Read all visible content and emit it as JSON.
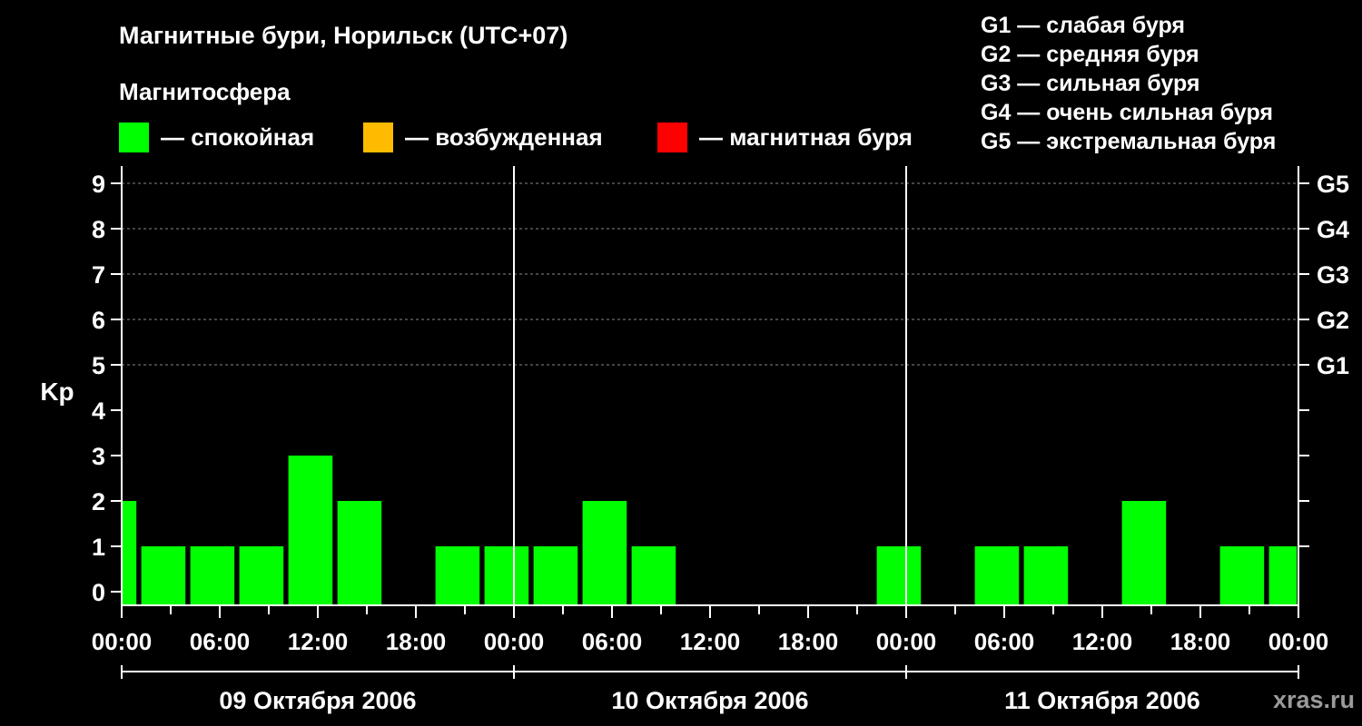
{
  "title": "Магнитные бури, Норильск (UTC+07)",
  "subtitle": "Магнитосфера",
  "legend": [
    {
      "label": "— спокойная",
      "color": "#00ff00"
    },
    {
      "label": "— возбужденная",
      "color": "#ffbb00"
    },
    {
      "label": "— магнитная буря",
      "color": "#ff0000"
    }
  ],
  "g_legend": [
    "G1 — слабая буря",
    "G2 — средняя буря",
    "G3 — сильная буря",
    "G4 — очень сильная буря",
    "G5 — экстремальная буря"
  ],
  "brand": "xras.ru",
  "chart_data": {
    "type": "bar",
    "ylabel": "Kp",
    "ylim": [
      0,
      9
    ],
    "yticks": [
      "0",
      "1",
      "2",
      "3",
      "4",
      "5",
      "6",
      "7",
      "8",
      "9"
    ],
    "right_ticks": [
      {
        "kp": 5,
        "label": "G1"
      },
      {
        "kp": 6,
        "label": "G2"
      },
      {
        "kp": 7,
        "label": "G3"
      },
      {
        "kp": 8,
        "label": "G4"
      },
      {
        "kp": 9,
        "label": "G5"
      }
    ],
    "grid": "dashed horizontal at Kp 5–9",
    "xlim_hours": [
      0,
      72
    ],
    "xtick_labels": [
      "00:00",
      "06:00",
      "12:00",
      "18:00",
      "00:00",
      "06:00",
      "12:00",
      "18:00",
      "00:00",
      "06:00",
      "12:00",
      "18:00",
      "00:00"
    ],
    "day_labels": [
      "09 Октября 2006",
      "10 Октября 2006",
      "11 Октября 2006"
    ],
    "bars": [
      {
        "start": 0,
        "end": 0.9,
        "kp": 2,
        "color": "#00ff00"
      },
      {
        "start": 1.2,
        "end": 3.9,
        "kp": 1,
        "color": "#00ff00"
      },
      {
        "start": 4.2,
        "end": 6.9,
        "kp": 1,
        "color": "#00ff00"
      },
      {
        "start": 7.2,
        "end": 9.9,
        "kp": 1,
        "color": "#00ff00"
      },
      {
        "start": 10.2,
        "end": 12.9,
        "kp": 3,
        "color": "#00ff00"
      },
      {
        "start": 13.2,
        "end": 15.9,
        "kp": 2,
        "color": "#00ff00"
      },
      {
        "start": 19.2,
        "end": 21.9,
        "kp": 1,
        "color": "#00ff00"
      },
      {
        "start": 22.2,
        "end": 24.9,
        "kp": 1,
        "color": "#00ff00"
      },
      {
        "start": 25.2,
        "end": 27.9,
        "kp": 1,
        "color": "#00ff00"
      },
      {
        "start": 28.2,
        "end": 30.9,
        "kp": 2,
        "color": "#00ff00"
      },
      {
        "start": 31.2,
        "end": 33.9,
        "kp": 1,
        "color": "#00ff00"
      },
      {
        "start": 46.2,
        "end": 48.9,
        "kp": 1,
        "color": "#00ff00"
      },
      {
        "start": 52.2,
        "end": 54.9,
        "kp": 1,
        "color": "#00ff00"
      },
      {
        "start": 55.2,
        "end": 57.9,
        "kp": 1,
        "color": "#00ff00"
      },
      {
        "start": 61.2,
        "end": 63.9,
        "kp": 2,
        "color": "#00ff00"
      },
      {
        "start": 67.2,
        "end": 69.9,
        "kp": 1,
        "color": "#00ff00"
      },
      {
        "start": 70.2,
        "end": 71.9,
        "kp": 1,
        "color": "#00ff00"
      }
    ]
  }
}
